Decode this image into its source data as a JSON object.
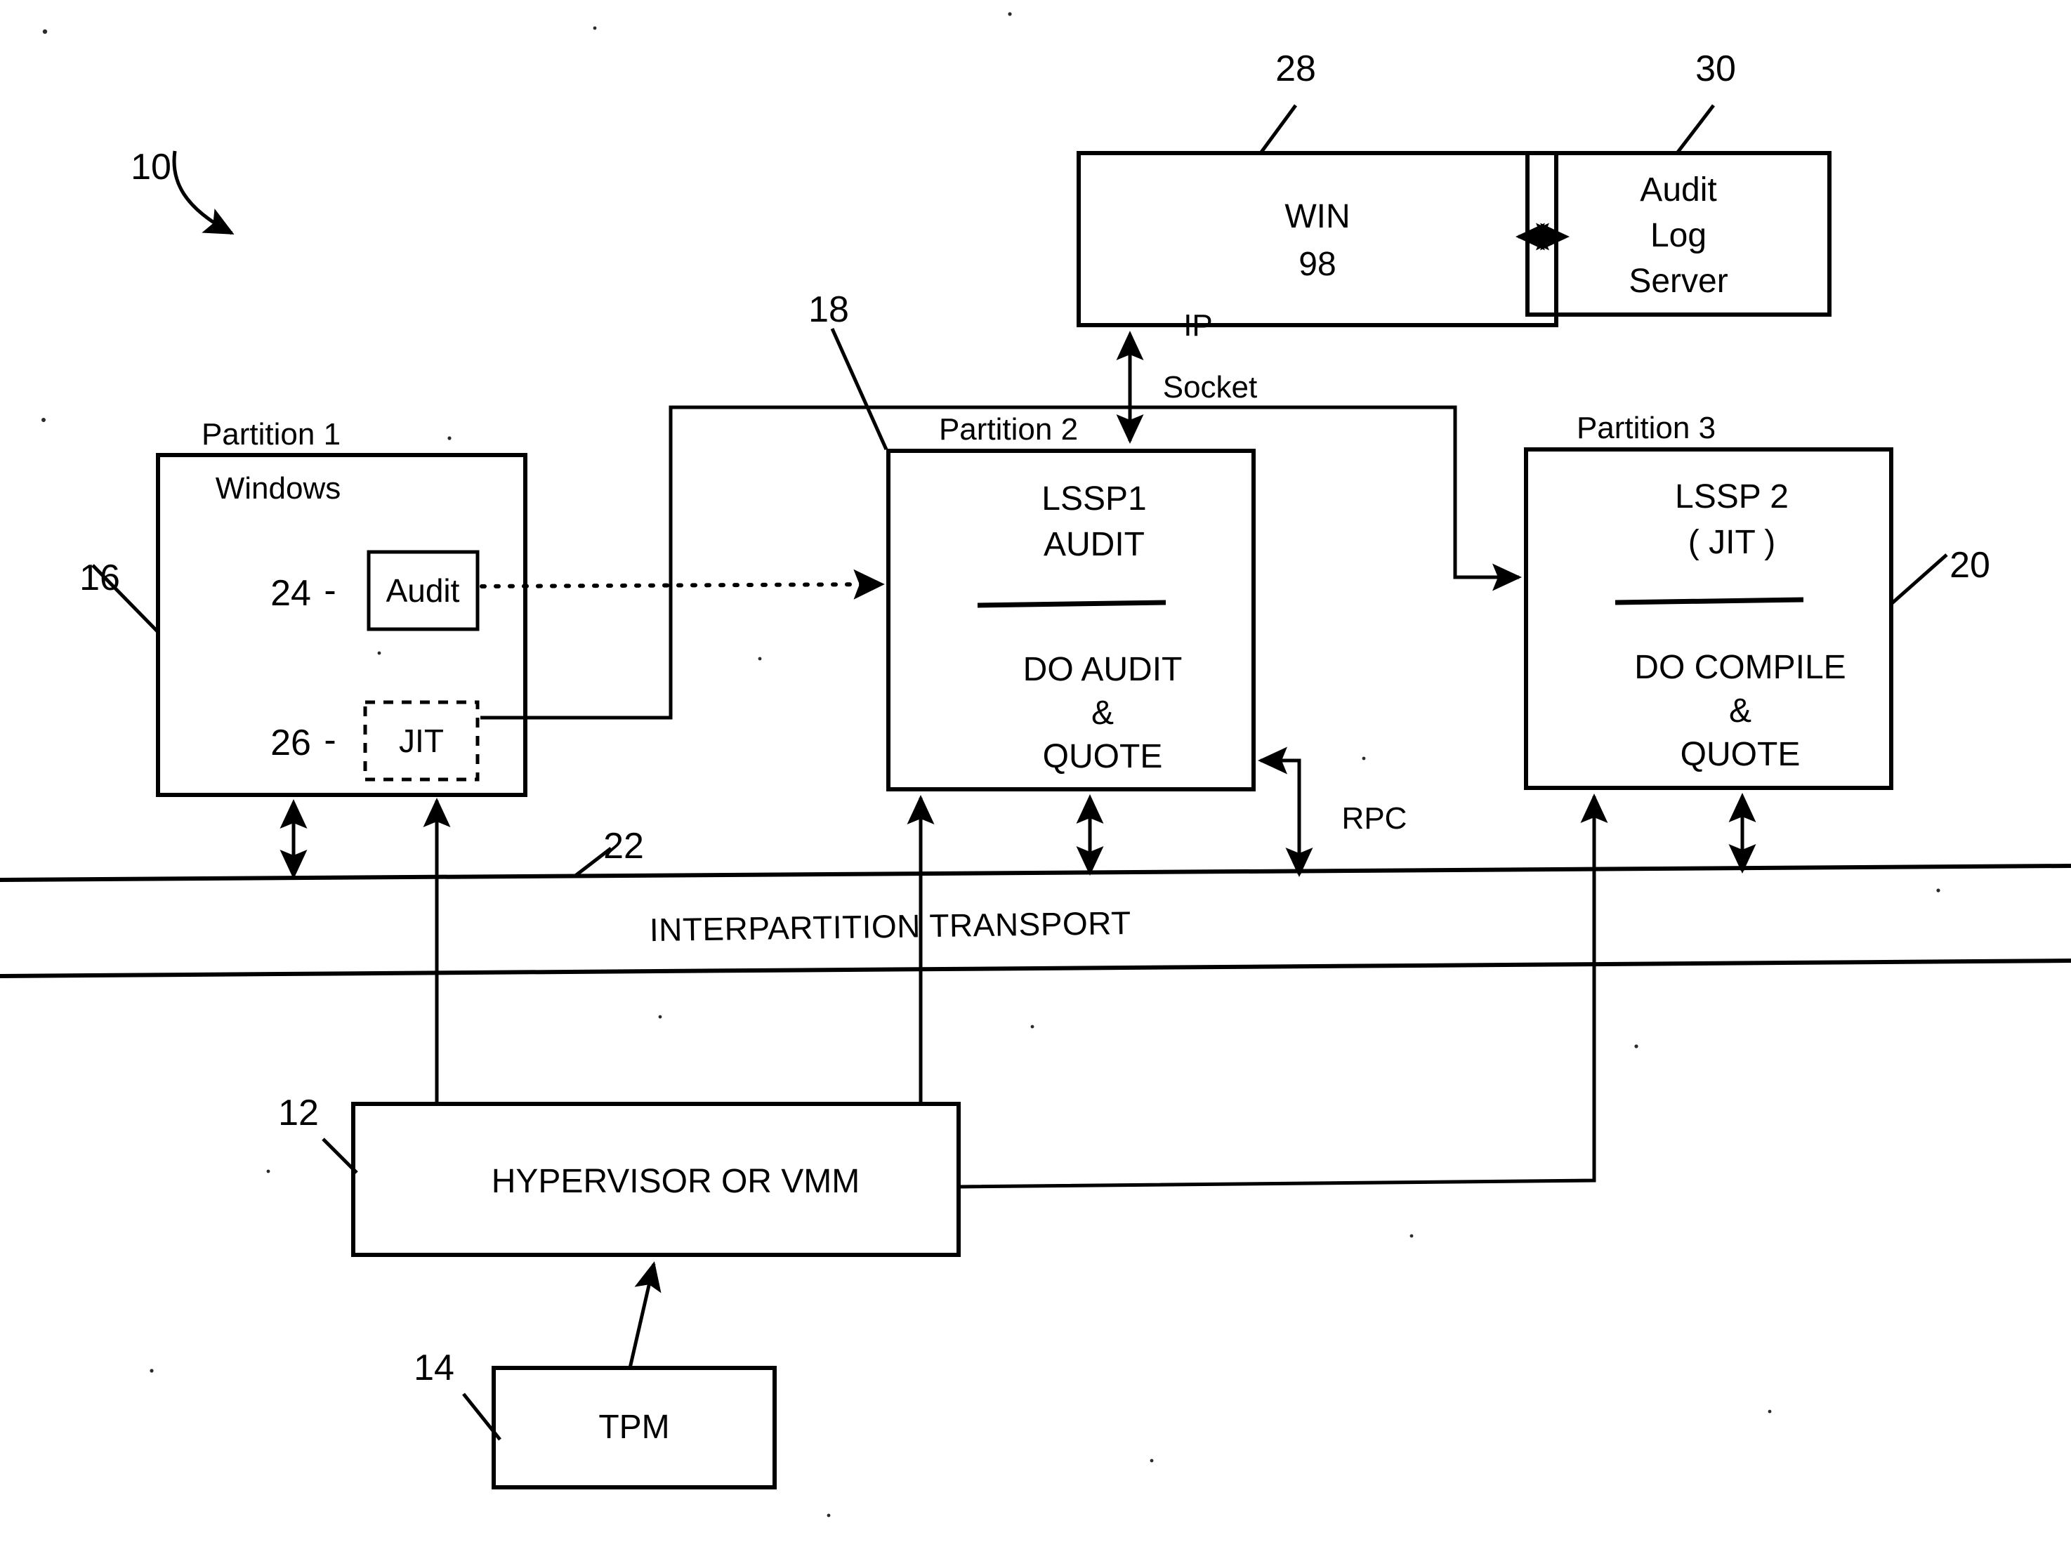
{
  "figure": {
    "ref_label": "10",
    "title_caption": "Partitioned virtualization architecture with audit and JIT service partitions"
  },
  "reference_numerals": {
    "system": "10",
    "hypervisor": "12",
    "tpm": "14",
    "partition1": "16",
    "partition2": "18",
    "partition3": "20",
    "transport": "22",
    "audit_module": "24",
    "jit_module": "26",
    "win98": "28",
    "audit_log_server": "30"
  },
  "nodes": {
    "win98": {
      "lines": [
        "WIN",
        "98"
      ],
      "ref": "28"
    },
    "audit_log_server": {
      "lines": [
        "Audit",
        "Log",
        "Server"
      ],
      "ref": "30"
    },
    "partition1": {
      "caption": "Partition 1",
      "os_label": "Windows",
      "ref": "16",
      "modules": [
        {
          "ref": "24",
          "dash": "-",
          "label": "Audit",
          "style": "solid"
        },
        {
          "ref": "26",
          "dash": "-",
          "label": "JIT",
          "style": "dashed"
        }
      ]
    },
    "partition2": {
      "caption": "Partition 2",
      "ref": "18",
      "title_lines": [
        "LSSP1",
        "AUDIT"
      ],
      "body_lines": [
        "DO AUDIT",
        "&",
        "QUOTE"
      ]
    },
    "partition3": {
      "caption": "Partition 3",
      "ref": "20",
      "title_lines": [
        "LSSP 2",
        "( JIT )"
      ],
      "body_lines": [
        "DO COMPILE",
        "&",
        "QUOTE"
      ]
    },
    "transport": {
      "label": "INTERPARTITION TRANSPORT",
      "ref": "22"
    },
    "hypervisor": {
      "label": "HYPERVISOR OR VMM",
      "ref": "12"
    },
    "tpm": {
      "label": "TPM",
      "ref": "14"
    }
  },
  "edge_labels": {
    "ip_socket_line1": "IP",
    "ip_socket_line2": "Socket",
    "rpc": "RPC"
  },
  "colors": {
    "ink": "#000000",
    "paper": "#ffffff"
  }
}
